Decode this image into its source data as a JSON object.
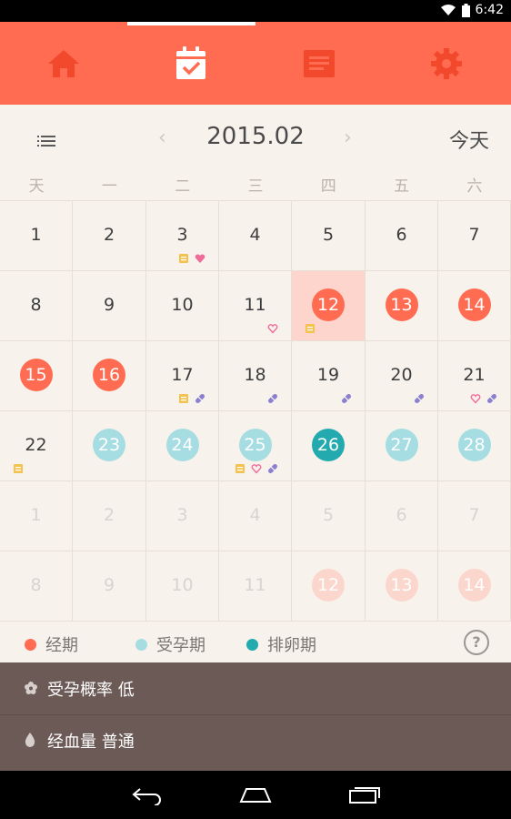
{
  "status": {
    "time": "6:42"
  },
  "nav": {
    "tabs": [
      "home",
      "calendar",
      "notes",
      "settings"
    ],
    "active": 1
  },
  "header": {
    "month": "2015.02",
    "today": "今天",
    "prev": "‹",
    "next": "›"
  },
  "weekdays": [
    "天",
    "一",
    "二",
    "三",
    "四",
    "五",
    "六"
  ],
  "calendar": {
    "rows": [
      [
        {
          "d": "1"
        },
        {
          "d": "2"
        },
        {
          "d": "3",
          "note": true,
          "heart": true
        },
        {
          "d": "4"
        },
        {
          "d": "5"
        },
        {
          "d": "6"
        },
        {
          "d": "7"
        }
      ],
      [
        {
          "d": "8"
        },
        {
          "d": "9"
        },
        {
          "d": "10"
        },
        {
          "d": "11",
          "heartOutline": true
        },
        {
          "d": "12",
          "type": "period",
          "highlight": true,
          "note": true
        },
        {
          "d": "13",
          "type": "period"
        },
        {
          "d": "14",
          "type": "period"
        }
      ],
      [
        {
          "d": "15",
          "type": "period"
        },
        {
          "d": "16",
          "type": "period"
        },
        {
          "d": "17",
          "note": true,
          "pill": true
        },
        {
          "d": "18",
          "pill": true
        },
        {
          "d": "19",
          "pill": true
        },
        {
          "d": "20",
          "pill": true
        },
        {
          "d": "21",
          "heartOutline": true,
          "pill": true
        }
      ],
      [
        {
          "d": "22",
          "note": true
        },
        {
          "d": "23",
          "type": "fertile"
        },
        {
          "d": "24",
          "type": "fertile"
        },
        {
          "d": "25",
          "type": "fertile",
          "note": true,
          "heartOutline": true,
          "pill": true
        },
        {
          "d": "26",
          "type": "ovulation"
        },
        {
          "d": "27",
          "type": "fertile"
        },
        {
          "d": "28",
          "type": "fertile"
        }
      ],
      [
        {
          "d": "1",
          "faded": true
        },
        {
          "d": "2",
          "faded": true
        },
        {
          "d": "3",
          "faded": true
        },
        {
          "d": "4",
          "faded": true
        },
        {
          "d": "5",
          "faded": true
        },
        {
          "d": "6",
          "faded": true
        },
        {
          "d": "7",
          "faded": true
        }
      ],
      [
        {
          "d": "8",
          "faded": true
        },
        {
          "d": "9",
          "faded": true
        },
        {
          "d": "10",
          "faded": true
        },
        {
          "d": "11",
          "faded": true
        },
        {
          "d": "12",
          "faded": true,
          "type": "period"
        },
        {
          "d": "13",
          "faded": true,
          "type": "period"
        },
        {
          "d": "14",
          "faded": true,
          "type": "period"
        }
      ]
    ]
  },
  "legend": {
    "period": "经期",
    "fertile": "受孕期",
    "ovulation": "排卵期",
    "help": "?"
  },
  "info": {
    "probability": "受孕概率 低",
    "flow": "经血量 普通"
  },
  "colors": {
    "accent": "#ff6c52",
    "fertile": "#a6dde3",
    "ovulation": "#22aaae",
    "panel": "#6c5a57"
  }
}
